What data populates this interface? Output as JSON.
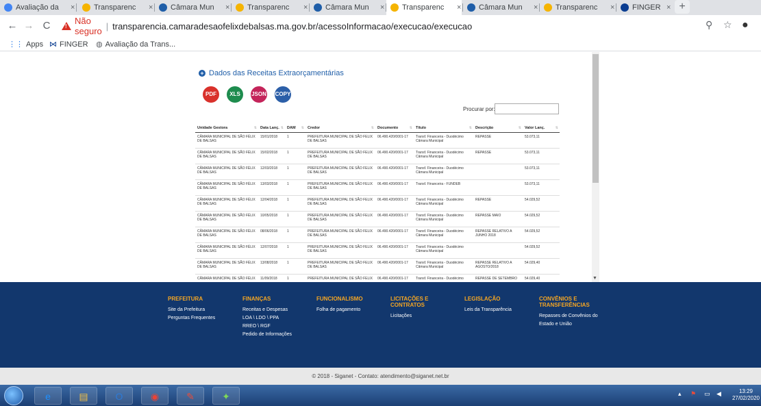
{
  "browser": {
    "tabs": [
      {
        "label": "Avaliação da",
        "icon": "chrome-icon",
        "active": false
      },
      {
        "label": "Transparenc",
        "icon": "yellow-logo-icon",
        "active": false
      },
      {
        "label": "Câmara Mun",
        "icon": "camara-icon",
        "active": false
      },
      {
        "label": "Transparenc",
        "icon": "yellow-logo-icon",
        "active": false
      },
      {
        "label": "Câmara Mun",
        "icon": "camara-icon",
        "active": false
      },
      {
        "label": "Transparenc",
        "icon": "yellow-logo-icon",
        "active": true
      },
      {
        "label": "Câmara Mun",
        "icon": "camara-icon",
        "active": false
      },
      {
        "label": "Transparenc",
        "icon": "yellow-logo-icon",
        "active": false
      },
      {
        "label": "FINGER",
        "icon": "finger-icon",
        "active": false
      }
    ],
    "insecure_label": "Não seguro",
    "url": "transparencia.camaradesaofelixdebalsas.ma.gov.br/acessoInformacao/execucao/execucao",
    "bookmarks": [
      {
        "label": "Apps",
        "icon": "apps-grid-icon"
      },
      {
        "label": "FINGER",
        "icon": "finger-icon"
      },
      {
        "label": "Avaliação da Trans...",
        "icon": "globe-icon"
      }
    ]
  },
  "page": {
    "section_title": "Dados das Receitas Extraorçamentárias",
    "export_buttons": [
      {
        "label": "PDF",
        "color": "#d9312b"
      },
      {
        "label": "XLS",
        "color": "#1e8c4e"
      },
      {
        "label": "JSON",
        "color": "#c4245a"
      },
      {
        "label": "COPY",
        "color": "#2c5fa8"
      }
    ],
    "search_label": "Procurar por:",
    "search_value": "",
    "columns": [
      "Unidade Gestora",
      "Data Lanç.",
      "DAM",
      "Credor",
      "Documento",
      "Título",
      "Descrição",
      "Valor Lanç."
    ],
    "rows": [
      [
        "CÂMARA MUNICIPAL DE SÃO FÉLIX DE BALSAS",
        "15/01/2018",
        "1",
        "PREFEITURA MUNICIPAL DE SÃO FELIX DE BALSAS",
        "06.490.420/0001-17",
        "Transf. Financeira - Duodécimo Câmara Municipal",
        "REPASSE",
        "53.073,11"
      ],
      [
        "CÂMARA MUNICIPAL DE SÃO FÉLIX DE BALSAS",
        "15/02/2018",
        "1",
        "PREFEITURA MUNICIPAL DE SÃO FELIX DE BALSAS",
        "06.490.420/0001-17",
        "Transf. Financeira - Duodécimo Câmara Municipal",
        "REPASSE",
        "53.073,11"
      ],
      [
        "CÂMARA MUNICIPAL DE SÃO FÉLIX DE BALSAS",
        "12/03/2018",
        "1",
        "PREFEITURA MUNICIPAL DE SÃO FELIX DE BALSAS",
        "06.490.420/0001-17",
        "Transf. Financeira - Duodécimo Câmara Municipal",
        "",
        "53.073,11"
      ],
      [
        "CÂMARA MUNICIPAL DE SÃO FÉLIX DE BALSAS",
        "13/03/2018",
        "1",
        "PREFEITURA MUNICIPAL DE SÃO FELIX DE BALSAS",
        "06.490.420/0001-17",
        "Transf. Financeira - FUNDEB",
        "",
        "53.073,11"
      ],
      [
        "CÂMARA MUNICIPAL DE SÃO FÉLIX DE BALSAS",
        "12/04/2018",
        "1",
        "PREFEITURA MUNICIPAL DE SÃO FELIX DE BALSAS",
        "06.490.420/0001-17",
        "Transf. Financeira - Duodécimo Câmara Municipal",
        "REPASSE",
        "54.029,52"
      ],
      [
        "CÂMARA MUNICIPAL DE SÃO FÉLIX DE BALSAS",
        "10/05/2018",
        "1",
        "PREFEITURA MUNICIPAL DE SÃO FELIX DE BALSAS",
        "06.490.420/0001-17",
        "Transf. Financeira - Duodécimo Câmara Municipal",
        "REPASSE MAIO",
        "54.029,52"
      ],
      [
        "CÂMARA MUNICIPAL DE SÃO FÉLIX DE BALSAS",
        "08/06/2018",
        "1",
        "PREFEITURA MUNICIPAL DE SÃO FELIX DE BALSAS",
        "06.490.420/0001-17",
        "Transf. Financeira - Duodécimo Câmara Municipal",
        "REPASSE RELATIVO A JUNHO 2018",
        "54.029,52"
      ],
      [
        "CÂMARA MUNICIPAL DE SÃO FÉLIX DE BALSAS",
        "12/07/2018",
        "1",
        "PREFEITURA MUNICIPAL DE SÃO FELIX DE BALSAS",
        "06.490.420/0001-17",
        "Transf. Financeira - Duodécimo Câmara Municipal",
        "",
        "54.029,52"
      ],
      [
        "CÂMARA MUNICIPAL DE SÃO FÉLIX DE BALSAS",
        "13/08/2018",
        "1",
        "PREFEITURA MUNICIPAL DE SÃO FELIX DE BALSAS",
        "06.490.420/0001-17",
        "Transf. Financeira - Duodécimo Câmara Municipal",
        "REPASSE RELATIVO A AGOSTO/2018",
        "54.029,40"
      ],
      [
        "CÂMARA MUNICIPAL DE SÃO FÉLIX DE BALSAS",
        "11/09/2018",
        "1",
        "PREFEITURA MUNICIPAL DE SÃO FELIX DE BALSAS",
        "06.490.420/0001-17",
        "Transf. Financeira - Duodécimo Câmara Municipal",
        "REPASSE DE SETEMBRO",
        "54.029,40"
      ]
    ]
  },
  "footer": {
    "columns": [
      {
        "heading": "PREFEITURA",
        "links": [
          "Site da Prefeitura",
          "Perguntas Frequentes"
        ]
      },
      {
        "heading": "FINANÇAS",
        "links": [
          "Receitas e Despesas",
          "LOA \\ LDO \\ PPA",
          "RREO \\ RGF",
          "Pedido de Informações"
        ]
      },
      {
        "heading": "FUNCIONALISMO",
        "links": [
          "Folha de pagamento"
        ]
      },
      {
        "heading": "LICITAÇÕES E CONTRATOS",
        "links": [
          "Licitações"
        ]
      },
      {
        "heading": "LEGISLAÇÃO",
        "links": [
          "Leis da Transparência"
        ]
      },
      {
        "heading": "CONVÊNIOS E TRANSFERÊNCIAS",
        "links": [
          "Repasses de Convênios do Estado e União"
        ]
      }
    ],
    "copyright": "© 2018 - Siganet - Contato: atendimento@siganet.net.br"
  },
  "taskbar": {
    "time": "13:29",
    "date": "27/02/2020",
    "apps": [
      "ie-icon",
      "explorer-icon",
      "outlook-icon",
      "chrome-icon",
      "paint-icon",
      "app-icon"
    ]
  }
}
